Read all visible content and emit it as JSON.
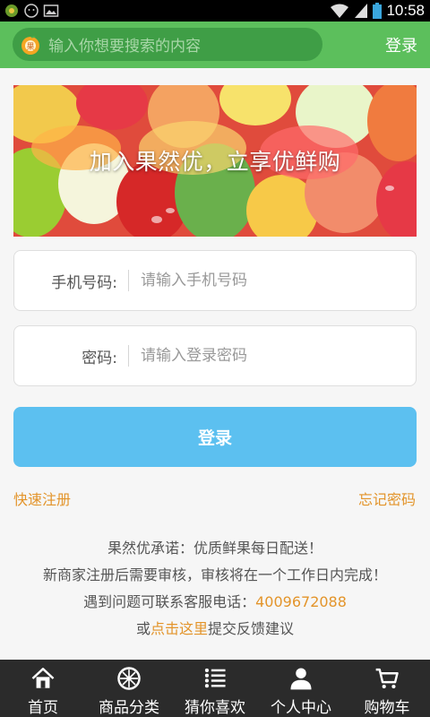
{
  "status_bar": {
    "time": "10:58"
  },
  "header": {
    "search_placeholder": "输入你想要搜索的内容",
    "login_label": "登录"
  },
  "banner": {
    "slogan": "加入果然优，立享优鲜购"
  },
  "form": {
    "phone_label": "手机号码:",
    "phone_placeholder": "请输入手机号码",
    "password_label": "密码:",
    "password_placeholder": "请输入登录密码",
    "submit_label": "登录"
  },
  "links": {
    "register": "快速注册",
    "forgot": "忘记密码"
  },
  "notes": {
    "line1": "果然优承诺：优质鲜果每日配送！",
    "line2": "新商家注册后需要审核，审核将在一个工作日内完成！",
    "line3_prefix": "遇到问题可联系客服电话：",
    "phone": "4009672088",
    "line4_prefix": "或",
    "line4_link": "点击这里",
    "line4_suffix": "提交反馈建议"
  },
  "tabs": [
    {
      "label": "首页",
      "icon": "home-icon"
    },
    {
      "label": "商品分类",
      "icon": "wheel-icon"
    },
    {
      "label": "猜你喜欢",
      "icon": "list-icon"
    },
    {
      "label": "个人中心",
      "icon": "person-icon"
    },
    {
      "label": "购物车",
      "icon": "cart-icon"
    }
  ],
  "colors": {
    "header_green": "#5cbf5c",
    "button_blue": "#5cc0f0",
    "link_orange": "#e3942a",
    "tabbar": "#2b2b2b"
  }
}
